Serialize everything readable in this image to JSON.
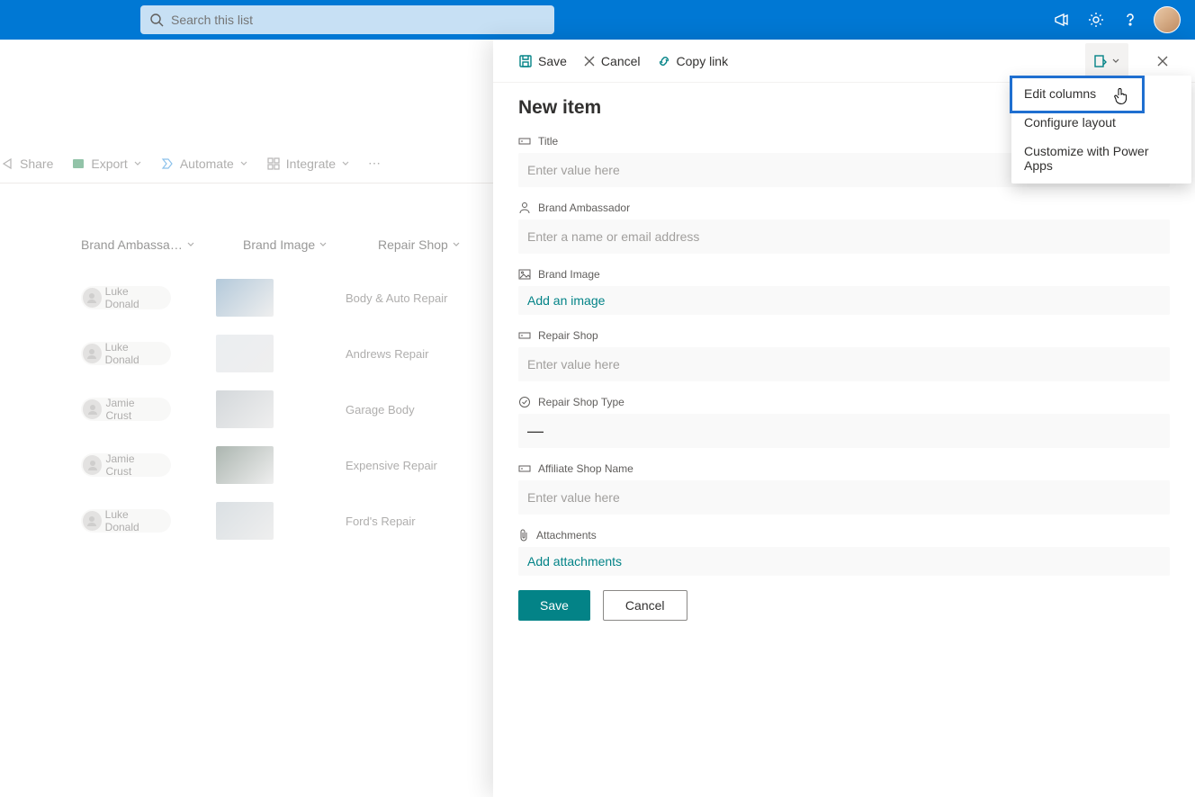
{
  "header": {
    "search_placeholder": "Search this list"
  },
  "commands": {
    "share": "Share",
    "export": "Export",
    "automate": "Automate",
    "integrate": "Integrate"
  },
  "list": {
    "columns": {
      "brand_ambassador": "Brand Ambassa…",
      "brand_image": "Brand Image",
      "repair_shop": "Repair Shop"
    },
    "rows": [
      {
        "ambassador": "Luke Donald",
        "shop": "Body & Auto Repair",
        "thumb_color": "#6a95b7"
      },
      {
        "ambassador": "Luke Donald",
        "shop": "Andrews Repair",
        "thumb_color": "#d8dee4"
      },
      {
        "ambassador": "Jamie Crust",
        "shop": "Garage Body",
        "thumb_color": "#aab2b8"
      },
      {
        "ambassador": "Jamie Crust",
        "shop": "Expensive Repair",
        "thumb_color": "#5b6e63"
      },
      {
        "ambassador": "Luke Donald",
        "shop": "Ford's Repair",
        "thumb_color": "#b7c2c9"
      }
    ]
  },
  "pane": {
    "toolbar": {
      "save": "Save",
      "cancel": "Cancel",
      "copy_link": "Copy link"
    },
    "title": "New item",
    "fields": {
      "title_label": "Title",
      "title_placeholder": "Enter value here",
      "ambassador_label": "Brand Ambassador",
      "ambassador_placeholder": "Enter a name or email address",
      "brand_image_label": "Brand Image",
      "brand_image_action": "Add an image",
      "repair_shop_label": "Repair Shop",
      "repair_shop_placeholder": "Enter value here",
      "repair_type_label": "Repair Shop Type",
      "repair_type_value": "—",
      "affiliate_label": "Affiliate Shop Name",
      "affiliate_placeholder": "Enter value here",
      "attachments_label": "Attachments",
      "attachments_action": "Add attachments"
    },
    "buttons": {
      "save": "Save",
      "cancel": "Cancel"
    },
    "menu": {
      "edit_columns": "Edit columns",
      "configure_layout": "Configure layout",
      "customize_power_apps": "Customize with Power Apps"
    }
  }
}
